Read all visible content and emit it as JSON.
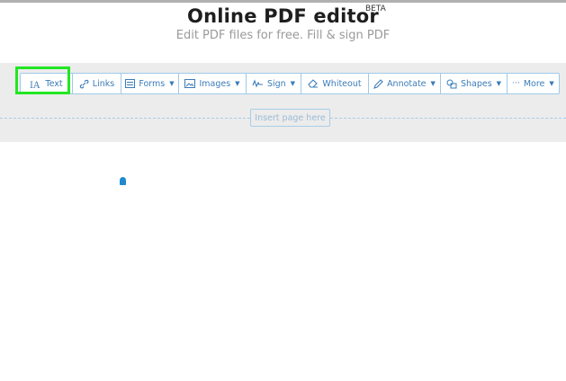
{
  "header": {
    "title": "Online PDF editor",
    "beta": "BETA",
    "subtitle": "Edit PDF files for free. Fill & sign PDF"
  },
  "toolbar": {
    "tools": [
      {
        "label": "Text",
        "icon": "text-icon"
      },
      {
        "label": "Links",
        "icon": "link-icon"
      },
      {
        "label": "Forms",
        "icon": "form-icon",
        "dropdown": true
      },
      {
        "label": "Images",
        "icon": "image-icon",
        "dropdown": true
      },
      {
        "label": "Sign",
        "icon": "signature-icon",
        "dropdown": true
      },
      {
        "label": "Whiteout",
        "icon": "eraser-icon"
      },
      {
        "label": "Annotate",
        "icon": "pencil-icon",
        "dropdown": true
      },
      {
        "label": "Shapes",
        "icon": "shapes-icon",
        "dropdown": true
      },
      {
        "label": "More",
        "icon": "ellipsis-icon",
        "dropdown": true
      }
    ],
    "selected": "Text"
  },
  "insert_page": {
    "label": "Insert page here"
  },
  "colors": {
    "accent": "#3a7cb8",
    "highlight": "#22e622",
    "band_bg": "#ececec"
  }
}
